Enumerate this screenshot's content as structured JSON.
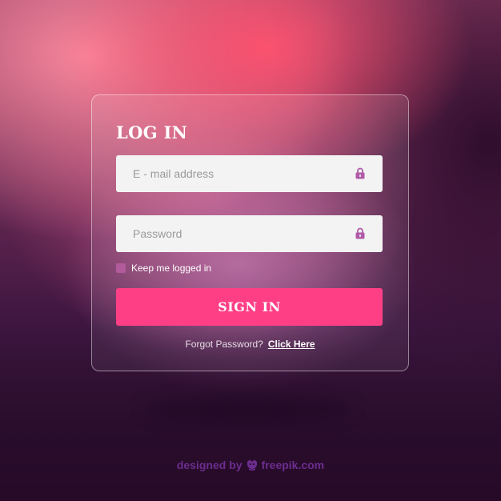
{
  "login": {
    "title": "LOG IN",
    "email_placeholder": "E - mail address",
    "password_placeholder": "Password",
    "remember_label": "Keep me logged in",
    "signin_label": "SIGN IN",
    "forgot_text": "Forgot Password?",
    "forgot_link": "Click Here"
  },
  "footer": {
    "designed_by": "designed by",
    "brand": "freepik.com"
  },
  "colors": {
    "accent": "#ff3f85",
    "checkbox": "#b15a9c",
    "lock_icon": "#b05aa8",
    "field_bg": "#f3f3f4",
    "credit": "#6d2d8f"
  },
  "icons": {
    "field_icon": "lock-icon",
    "brand_icon": "freepik-logo-icon"
  }
}
